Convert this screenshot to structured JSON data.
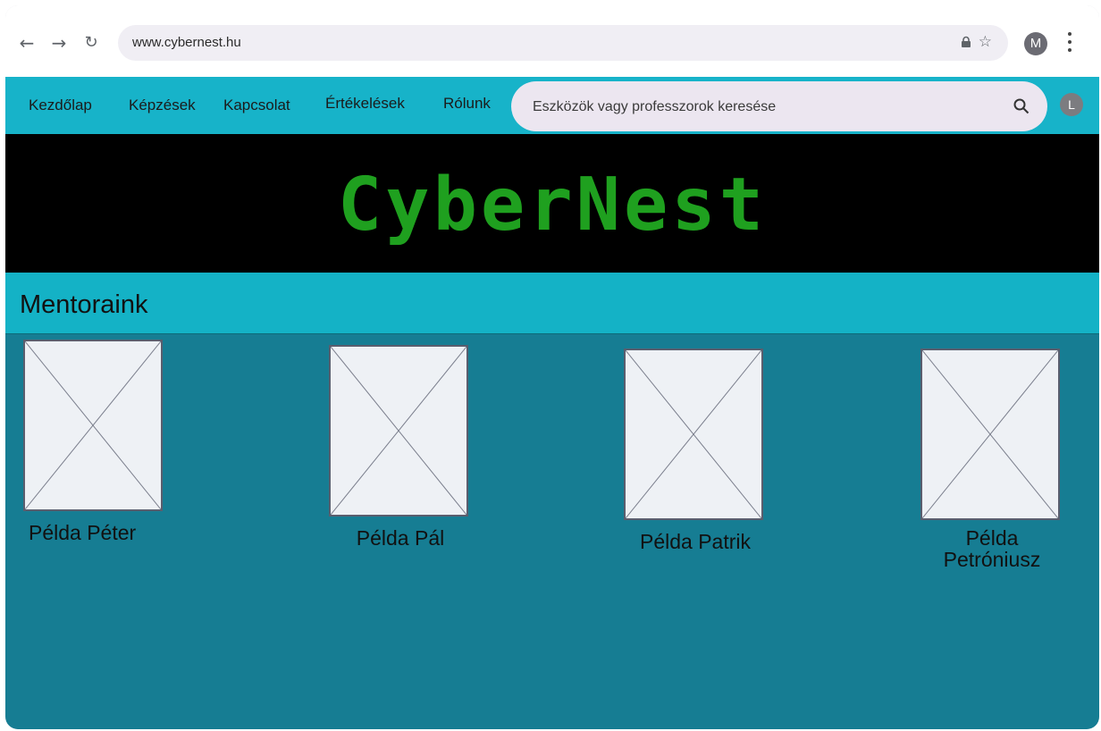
{
  "browser": {
    "url": "www.cybernest.hu",
    "profile_initial": "M",
    "back_icon": "arrow-left-icon",
    "forward_icon": "arrow-right-icon",
    "reload_icon": "reload-icon"
  },
  "site_nav": {
    "links": [
      {
        "label": "Kezdőlap"
      },
      {
        "label": "Képzések"
      },
      {
        "label": "Kapcsolat"
      },
      {
        "label": "Értékelések"
      },
      {
        "label": "Rólunk"
      }
    ],
    "search_placeholder": "Eszközök vagy professzorok keresése",
    "avatar_initial": "L"
  },
  "banner": {
    "logo_text": "CyberNest",
    "logo_color": "#1fa01f"
  },
  "section": {
    "title": "Mentoraink"
  },
  "mentors": [
    {
      "name": "Példa Péter"
    },
    {
      "name": "Példa Pál"
    },
    {
      "name": "Példa Patrik"
    },
    {
      "name": "Példa Petróniusz"
    }
  ],
  "colors": {
    "nav_bg": "#17b3c9",
    "mentors_bg": "#167d93",
    "banner_bg": "#000000"
  }
}
